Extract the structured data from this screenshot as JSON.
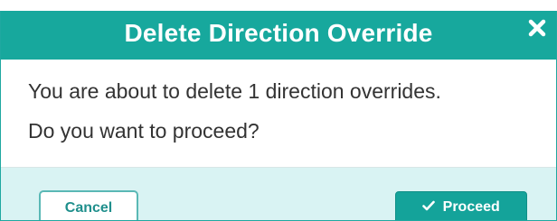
{
  "dialog": {
    "title": "Delete Direction Override",
    "close_icon": "close-icon",
    "message_line1": "You are about to delete 1 direction overrides.",
    "message_line2": "Do you want to proceed?",
    "cancel_label": "Cancel",
    "proceed_label": "Proceed",
    "proceed_icon": "check-icon"
  },
  "colors": {
    "header": "#17a89d",
    "footer": "#d9f3f3",
    "primary_button": "#14a39a",
    "cancel_border": "#5ab8b5",
    "body_text": "#333333"
  }
}
